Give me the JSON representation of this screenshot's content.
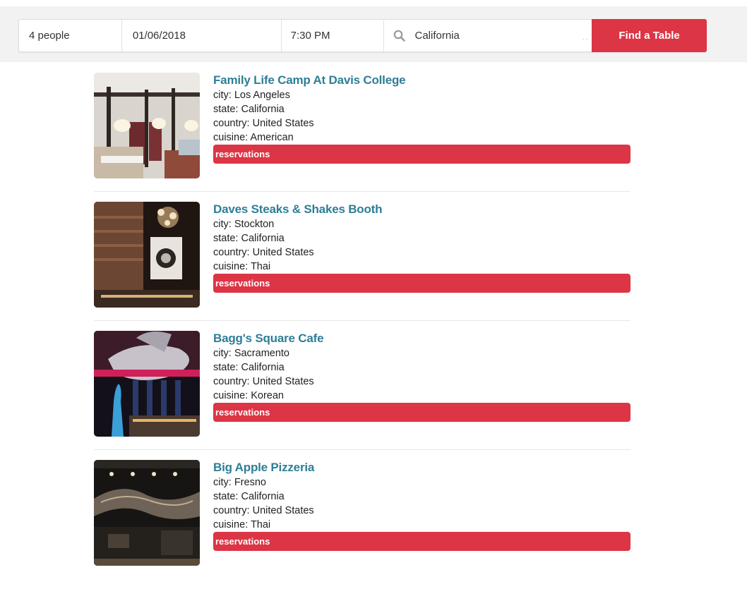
{
  "search": {
    "people": "4 people",
    "date": "01/06/2018",
    "time": "7:30 PM",
    "location": "California",
    "button_label": "Find a Table"
  },
  "labels": {
    "city": "city: ",
    "state": "state: ",
    "country": "country: ",
    "cuisine": "cuisine: ",
    "reservations": "reservations"
  },
  "restaurants": [
    {
      "name": "Family Life Camp At Davis College",
      "city": "Los Angeles",
      "state": "California",
      "country": "United States",
      "cuisine": "American"
    },
    {
      "name": "Daves Steaks & Shakes Booth",
      "city": "Stockton",
      "state": "California",
      "country": "United States",
      "cuisine": "Thai"
    },
    {
      "name": "Bagg's Square Cafe",
      "city": "Sacramento",
      "state": "California",
      "country": "United States",
      "cuisine": "Korean"
    },
    {
      "name": "Big Apple Pizzeria",
      "city": "Fresno",
      "state": "California",
      "country": "United States",
      "cuisine": "Thai"
    }
  ],
  "colors": {
    "accent_red": "#dc3545",
    "link_teal": "#2e7e96"
  }
}
